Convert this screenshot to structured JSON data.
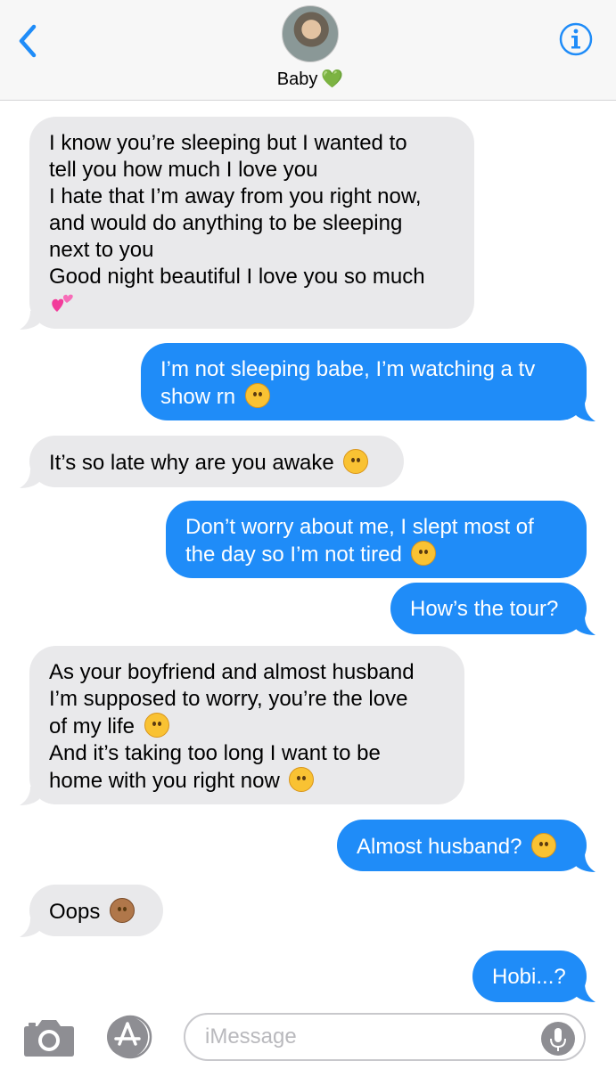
{
  "header": {
    "contact_name": "Baby",
    "name_emoji": "💚",
    "back_icon": "chevron-left-icon",
    "info_icon": "info-icon",
    "accent_color": "#1f8cf8"
  },
  "messages": [
    {
      "direction": "incoming",
      "lines": [
        "I know you’re sleeping but I wanted to",
        "tell you how much I love you",
        "I hate that I’m away from you right now,",
        "and would do anything to be sleeping",
        "next to you",
        "Good night beautiful I love you so much"
      ],
      "emoji": "💕"
    },
    {
      "direction": "outgoing",
      "lines": [
        "I’m not sleeping babe, I’m watching a tv",
        "show rn"
      ],
      "emoji": "🤗"
    },
    {
      "direction": "incoming",
      "lines": [
        "It’s so late why are you awake"
      ],
      "emoji": "😩"
    },
    {
      "direction": "outgoing",
      "lines": [
        "Don’t worry about me, I slept most of",
        "the day so I’m not tired"
      ],
      "emoji": "😅"
    },
    {
      "direction": "outgoing",
      "lines": [
        "How’s the tour?"
      ]
    },
    {
      "direction": "incoming",
      "lines": [
        "As your boyfriend and almost husband",
        "I’m supposed to worry, you’re the love",
        "of my life",
        "And it’s taking too long I want to be",
        "home with you right now"
      ],
      "emojis": {
        "line3": "😤",
        "line5": "😢"
      }
    },
    {
      "direction": "outgoing",
      "lines": [
        "Almost husband?"
      ],
      "emoji": "😳"
    },
    {
      "direction": "incoming",
      "lines": [
        "Oops"
      ],
      "emoji": "🙊"
    },
    {
      "direction": "outgoing",
      "lines": [
        "Hobi...?"
      ]
    }
  ],
  "colors": {
    "incoming_bubble": "#e9e9eb",
    "outgoing_bubble": "#1f8cf8"
  },
  "composer": {
    "placeholder": "iMessage",
    "camera_icon": "camera-icon",
    "apps_icon": "app-store-icon",
    "mic_icon": "microphone-icon"
  }
}
